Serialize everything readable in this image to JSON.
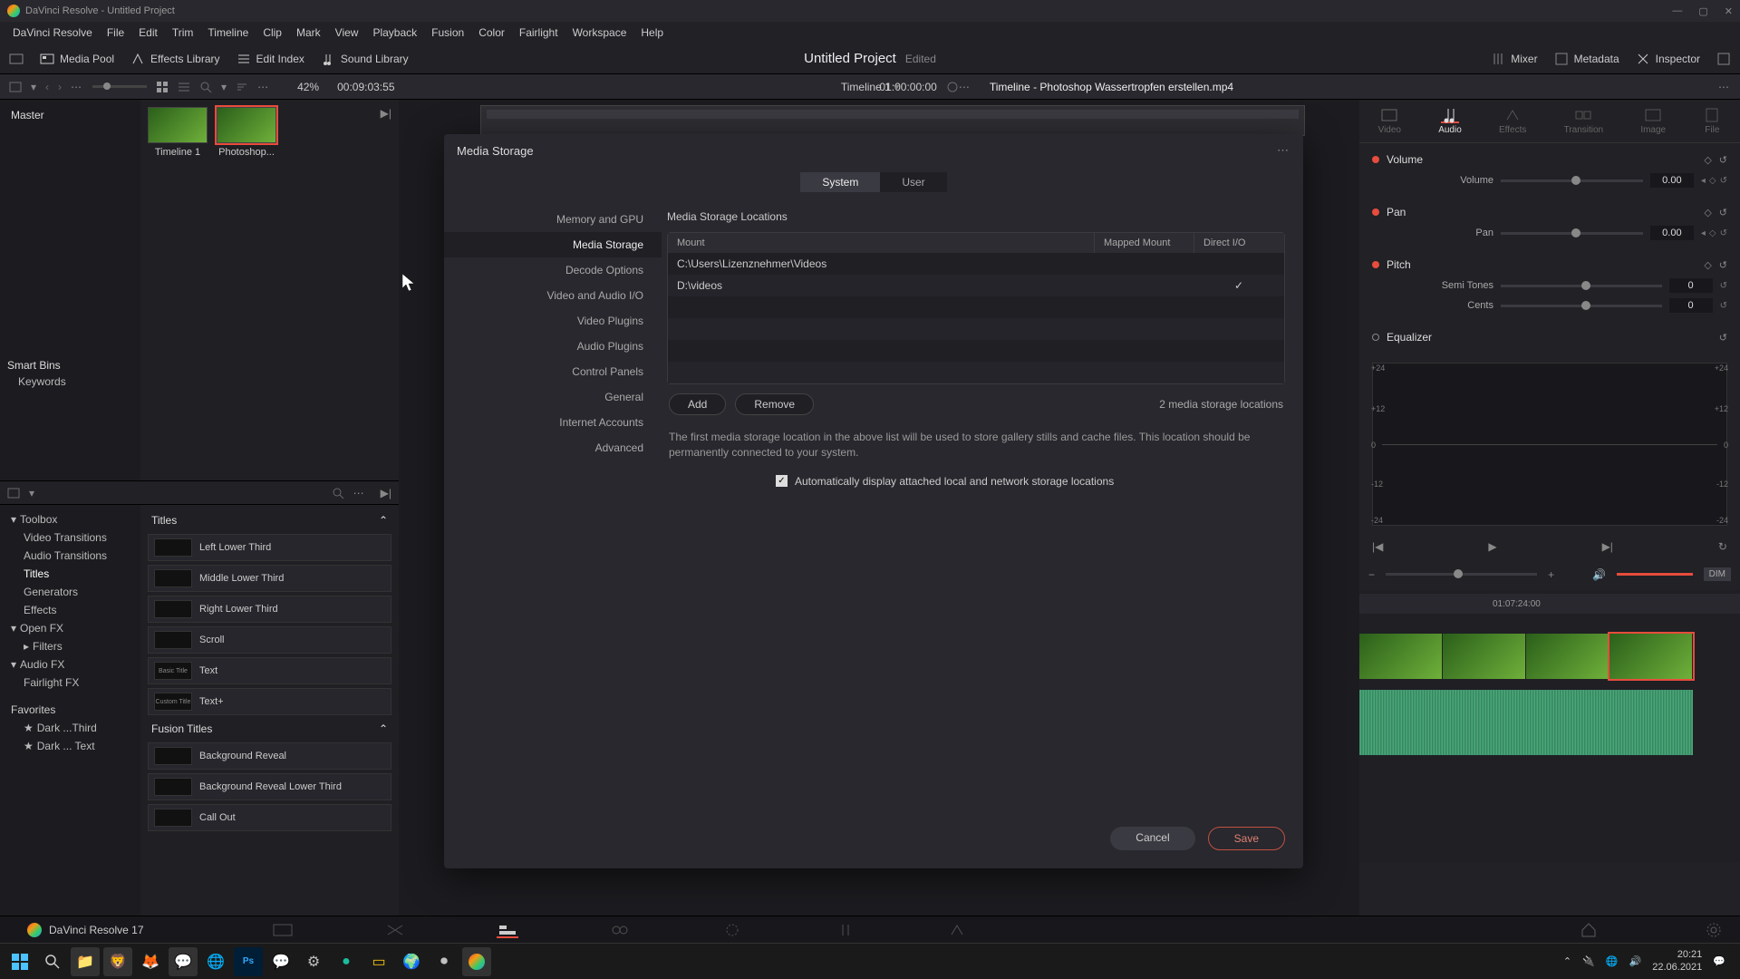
{
  "titlebar": {
    "text": "DaVinci Resolve - Untitled Project"
  },
  "menubar": [
    "DaVinci Resolve",
    "File",
    "Edit",
    "Trim",
    "Timeline",
    "Clip",
    "Mark",
    "View",
    "Playback",
    "Fusion",
    "Color",
    "Fairlight",
    "Workspace",
    "Help"
  ],
  "toolbar": {
    "media_pool": "Media Pool",
    "effects_library": "Effects Library",
    "edit_index": "Edit Index",
    "sound_library": "Sound Library",
    "project_title": "Untitled Project",
    "project_state": "Edited",
    "mixer": "Mixer",
    "metadata": "Metadata",
    "inspector": "Inspector"
  },
  "infobar": {
    "zoom": "42%",
    "timecode_left": "00:09:03:55",
    "timeline_name": "Timeline 1",
    "timecode_right": "01:00:00:00",
    "inspector_title": "Timeline - Photoshop Wassertropfen erstellen.mp4"
  },
  "mediapool": {
    "master": "Master",
    "smart_bins": "Smart Bins",
    "keywords": "Keywords",
    "clips": [
      {
        "name": "Timeline 1"
      },
      {
        "name": "Photoshop..."
      }
    ]
  },
  "fx": {
    "search_placeholder": "",
    "tree": {
      "toolbox": "Toolbox",
      "video_transitions": "Video Transitions",
      "audio_transitions": "Audio Transitions",
      "titles": "Titles",
      "generators": "Generators",
      "effects": "Effects",
      "open_fx": "Open FX",
      "filters": "Filters",
      "audio_fx": "Audio FX",
      "fairlight_fx": "Fairlight FX",
      "favorites": "Favorites",
      "fav1": "Dark ...Third",
      "fav2": "Dark ... Text"
    },
    "titles_hdr": "Titles",
    "titles_items": [
      "Left Lower Third",
      "Middle Lower Third",
      "Right Lower Third",
      "Scroll",
      "Text",
      "Text+"
    ],
    "titles_prev": [
      "",
      "",
      "",
      "",
      "Basic Title",
      "Custom Title"
    ],
    "fusion_hdr": "Fusion Titles",
    "fusion_items": [
      "Background Reveal",
      "Background Reveal Lower Third",
      "Call Out"
    ]
  },
  "inspector": {
    "tabs": [
      "Video",
      "Audio",
      "Effects",
      "Transition",
      "Image",
      "File"
    ],
    "active_tab": 1,
    "volume": {
      "label": "Volume",
      "param": "Volume",
      "value": "0.00"
    },
    "pan": {
      "label": "Pan",
      "param": "Pan",
      "value": "0.00"
    },
    "pitch": {
      "label": "Pitch",
      "semi": "Semi Tones",
      "semi_val": "0",
      "cents": "Cents",
      "cents_val": "0"
    },
    "equalizer": {
      "label": "Equalizer"
    },
    "eq_ticks": [
      "+24",
      "+12",
      "0",
      "-12",
      "-24"
    ],
    "dim": "DIM"
  },
  "timeline": {
    "ruler_tick": "01:07:24:00"
  },
  "modal": {
    "title": "Media Storage",
    "tab_system": "System",
    "tab_user": "User",
    "side": [
      "Memory and GPU",
      "Media Storage",
      "Decode Options",
      "Video and Audio I/O",
      "Video Plugins",
      "Audio Plugins",
      "Control Panels",
      "General",
      "Internet Accounts",
      "Advanced"
    ],
    "active_side": 1,
    "section_hdr": "Media Storage Locations",
    "col_mount": "Mount",
    "col_mapped": "Mapped Mount",
    "col_direct": "Direct I/O",
    "rows": [
      {
        "mount": "C:\\Users\\Lizenznehmer\\Videos",
        "mapped": "",
        "direct": false
      },
      {
        "mount": "D:\\videos",
        "mapped": "",
        "direct": true
      }
    ],
    "add": "Add",
    "remove": "Remove",
    "count_text": "2 media storage locations",
    "note": "The first media storage location in the above list will be used to store gallery stills and cache files. This location should be permanently connected to your system.",
    "auto_check": "Automatically display attached local and network storage locations",
    "cancel": "Cancel",
    "save": "Save"
  },
  "app_label": "DaVinci Resolve 17",
  "taskbar": {
    "time": "20:21",
    "date": "22.06.2021"
  }
}
